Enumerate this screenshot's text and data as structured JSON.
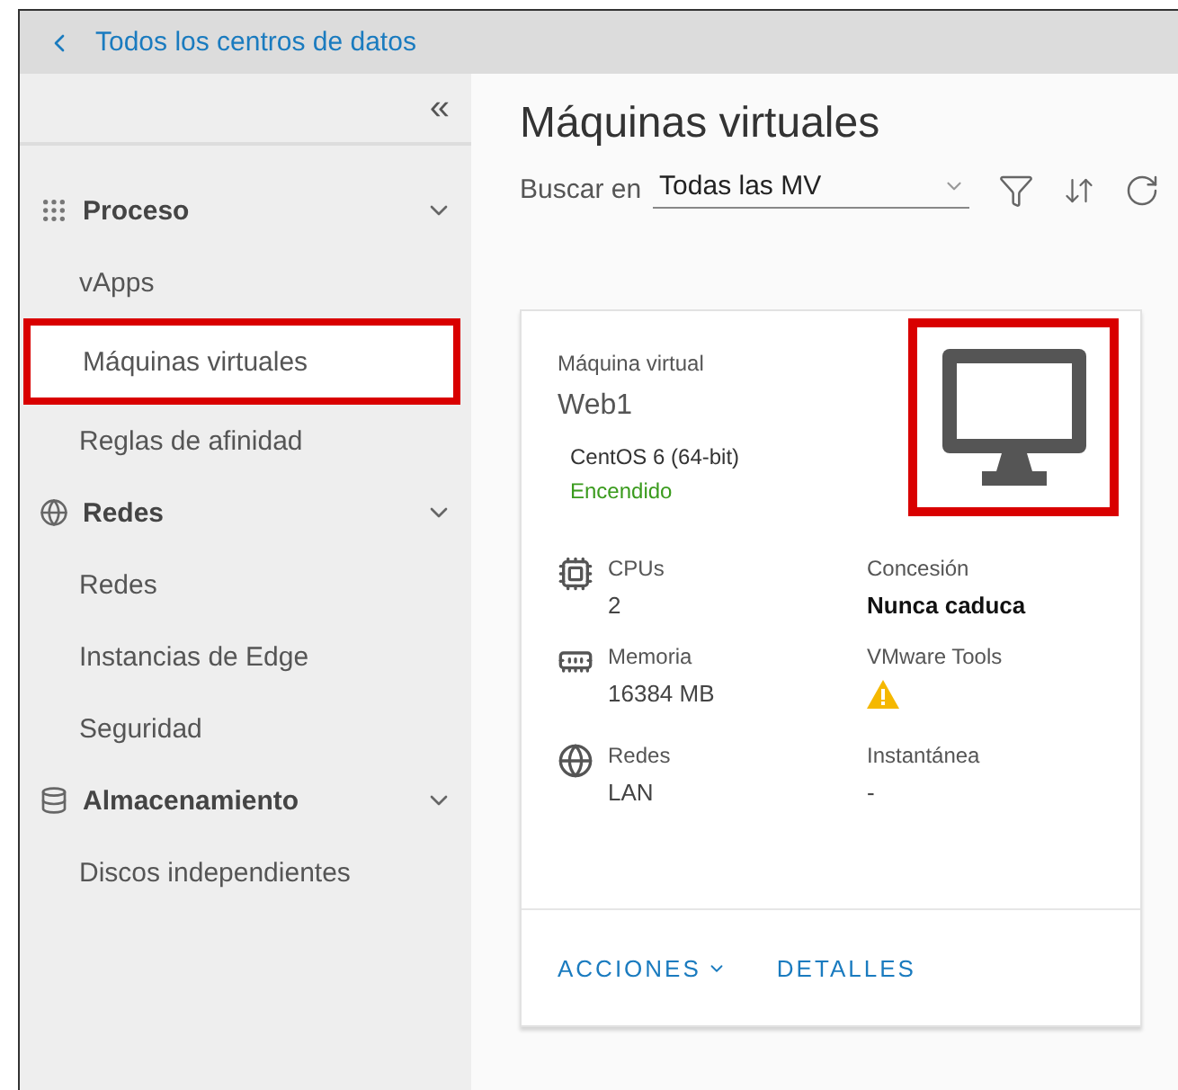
{
  "breadcrumb": {
    "label": "Todos los centros de datos"
  },
  "sidebar": {
    "collapse_label": "«",
    "groups": [
      {
        "kind": "grid",
        "label": "Proceso",
        "expanded": true,
        "items": [
          {
            "label": "vApps",
            "selected": false,
            "annotated": false
          },
          {
            "label": "Máquinas virtuales",
            "selected": true,
            "annotated": true
          },
          {
            "label": "Reglas de afinidad",
            "selected": false,
            "annotated": false
          }
        ]
      },
      {
        "kind": "globe",
        "label": "Redes",
        "expanded": true,
        "items": [
          {
            "label": "Redes",
            "selected": false,
            "annotated": false
          },
          {
            "label": "Instancias de Edge",
            "selected": false,
            "annotated": false
          },
          {
            "label": "Seguridad",
            "selected": false,
            "annotated": false
          }
        ]
      },
      {
        "kind": "storage",
        "label": "Almacenamiento",
        "expanded": true,
        "items": [
          {
            "label": "Discos independientes",
            "selected": false,
            "annotated": false
          }
        ]
      }
    ]
  },
  "main": {
    "title": "Máquinas virtuales",
    "search_label": "Buscar en",
    "search_value": "Todas las MV"
  },
  "card": {
    "type_label": "Máquina virtual",
    "name": "Web1",
    "os": "CentOS 6 (64-bit)",
    "status": "Encendido",
    "powered_on": true,
    "icon_annotated": true,
    "specs": [
      {
        "kind": "cpu",
        "label": "CPUs",
        "value": "2"
      },
      {
        "kind": "memory",
        "label": "Memoria",
        "value": "16384 MB"
      },
      {
        "kind": "network",
        "label": "Redes",
        "value": "LAN"
      }
    ],
    "properties": [
      {
        "kind": "bold",
        "label": "Concesión",
        "value": "Nunca caduca"
      },
      {
        "kind": "warning",
        "label": "VMware Tools"
      },
      {
        "kind": "text",
        "label": "Instantánea",
        "value": "-"
      }
    ],
    "actions": [
      {
        "label": "ACCIONES",
        "dropdown": true
      },
      {
        "label": "DETALLES",
        "dropdown": false
      }
    ]
  }
}
